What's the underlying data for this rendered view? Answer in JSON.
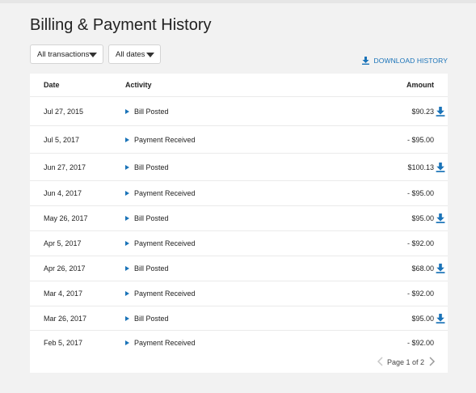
{
  "page": {
    "title": "Billing & Payment History"
  },
  "filters": {
    "transactions_label": "All transactions",
    "dates_label": "All dates"
  },
  "download_history": "DOWNLOAD HISTORY",
  "table": {
    "headers": {
      "date": "Date",
      "activity": "Activity",
      "amount": "Amount"
    },
    "rows": [
      {
        "date": "Jul 27, 2015",
        "activity": "Bill Posted",
        "amount": "$90.23",
        "downloadable": true
      },
      {
        "date": "Jul 5, 2017",
        "activity": "Payment Received",
        "amount": "- $95.00",
        "downloadable": false
      },
      {
        "date": "Jun 27, 2017",
        "activity": "Bill Posted",
        "amount": "$100.13",
        "downloadable": true
      },
      {
        "date": "Jun 4, 2017",
        "activity": "Payment Received",
        "amount": "- $95.00",
        "downloadable": false
      },
      {
        "date": "May 26, 2017",
        "activity": "Bill Posted",
        "amount": "$95.00",
        "downloadable": true
      },
      {
        "date": "Apr 5, 2017",
        "activity": "Payment Received",
        "amount": "- $92.00",
        "downloadable": false
      },
      {
        "date": "Apr 26, 2017",
        "activity": "Bill Posted",
        "amount": "$68.00",
        "downloadable": true
      },
      {
        "date": "Mar 4, 2017",
        "activity": "Payment Received",
        "amount": "- $92.00",
        "downloadable": false
      },
      {
        "date": "Mar 26, 2017",
        "activity": "Bill Posted",
        "amount": "$95.00",
        "downloadable": true
      },
      {
        "date": "Feb 5, 2017",
        "activity": "Payment Received",
        "amount": "- $92.00",
        "downloadable": false
      }
    ]
  },
  "pagination": {
    "label": "Page 1 of 2"
  },
  "colors": {
    "accent": "#1a73b8",
    "background": "#f2f2f2",
    "disabled": "#c8c8c8",
    "arrow_active": "#9a9a9a"
  },
  "icons": {
    "download": "download-icon",
    "dropdown": "caret-down-icon",
    "row_expand": "triangle-right-icon",
    "prev": "chevron-left-icon",
    "next": "chevron-right-icon"
  }
}
